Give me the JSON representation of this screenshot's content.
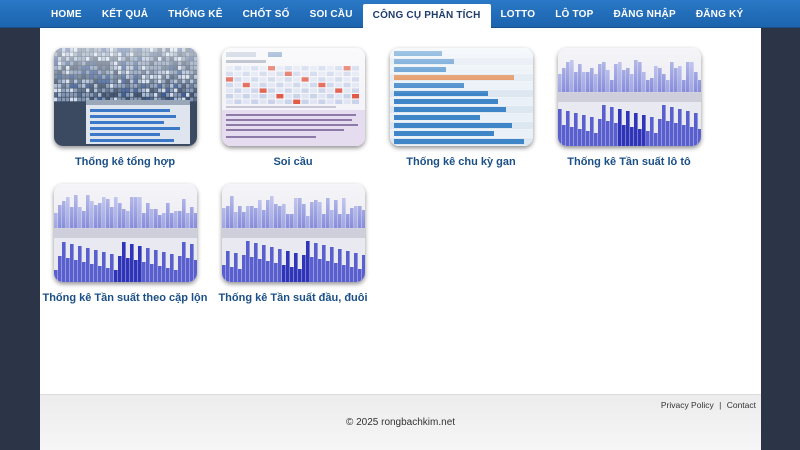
{
  "nav": {
    "items": [
      {
        "label": "HOME"
      },
      {
        "label": "KẾT QUẢ"
      },
      {
        "label": "THỐNG KÊ"
      },
      {
        "label": "CHỐT SỐ"
      },
      {
        "label": "SOI CẦU"
      },
      {
        "label": "CÔNG CỤ PHÂN TÍCH",
        "active": true
      },
      {
        "label": "LOTTO"
      },
      {
        "label": "LÔ TOP"
      },
      {
        "label": "ĐĂNG NHẬP"
      },
      {
        "label": "ĐĂNG KÝ"
      }
    ]
  },
  "tools": [
    {
      "title": "Thống kê tổng hợp",
      "thumbnail": "dark-grid-screenshot"
    },
    {
      "title": "Soi cầu",
      "thumbnail": "number-table-screenshot"
    },
    {
      "title": "Thống kê chu kỳ gan",
      "thumbnail": "bar-list-screenshot"
    },
    {
      "title": "Thống kê Tần suất lô tô",
      "thumbnail": "frequency-chart-screenshot"
    },
    {
      "title": "Thống kê Tần suất theo cặp lộn",
      "thumbnail": "frequency-chart-screenshot"
    },
    {
      "title": "Thống kê Tần suất đầu, đuôi",
      "thumbnail": "frequency-chart-screenshot"
    }
  ],
  "footer": {
    "privacy_label": "Privacy Policy",
    "separator": "|",
    "contact_label": "Contact",
    "copyright": "© 2025 rongbachkim.net"
  },
  "colors": {
    "nav_bg": "#1f6bb5",
    "page_bg": "#2c3447",
    "link": "#1b4f87"
  }
}
